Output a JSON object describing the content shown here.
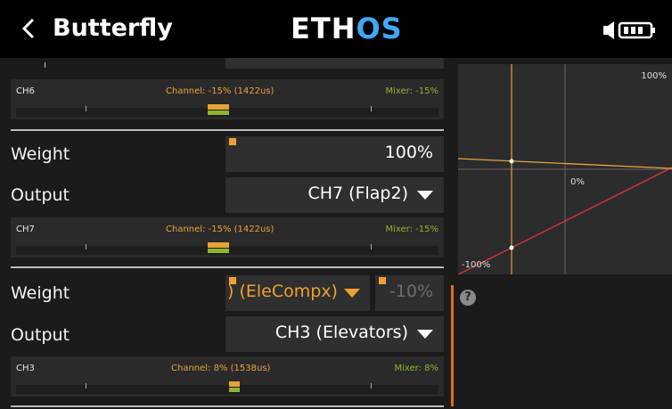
{
  "header": {
    "title": "Butterfly",
    "logo_main": "ETH",
    "logo_accent": "OS"
  },
  "colors": {
    "accent_orange": "#e8a23a",
    "mixer_green": "#8fb52c",
    "logo_blue": "#3fa9f5",
    "curve_red": "#e0333a"
  },
  "icons": [
    "back-icon",
    "speaker-icon",
    "battery-icon",
    "help-icon"
  ],
  "ch6_monitor": {
    "channel": "CH6",
    "channel_value": "Channel: -15% (1422us)",
    "mixer_value": "Mixer: -15%"
  },
  "section_flap2": {
    "weight_label": "Weight",
    "weight_value": "100%",
    "output_label": "Output",
    "output_value": "CH7 (Flap2)",
    "monitor": {
      "channel": "CH7",
      "channel_value": "Channel: -15% (1422us)",
      "mixer_value": "Mixer: -15%"
    }
  },
  "section_elevators": {
    "weight_label": "Weight",
    "weight_source": ") (EleCompx)",
    "weight_value": "-10%",
    "output_label": "Output",
    "output_value": "CH3 (Elevators)",
    "monitor": {
      "channel": "CH3",
      "channel_value": "Channel: 8% (1538us)",
      "mixer_value": "Mixer: 8%"
    }
  },
  "graph": {
    "label_top": "100%",
    "label_mid": "0%",
    "label_bottom": "-100%"
  },
  "help": "?"
}
